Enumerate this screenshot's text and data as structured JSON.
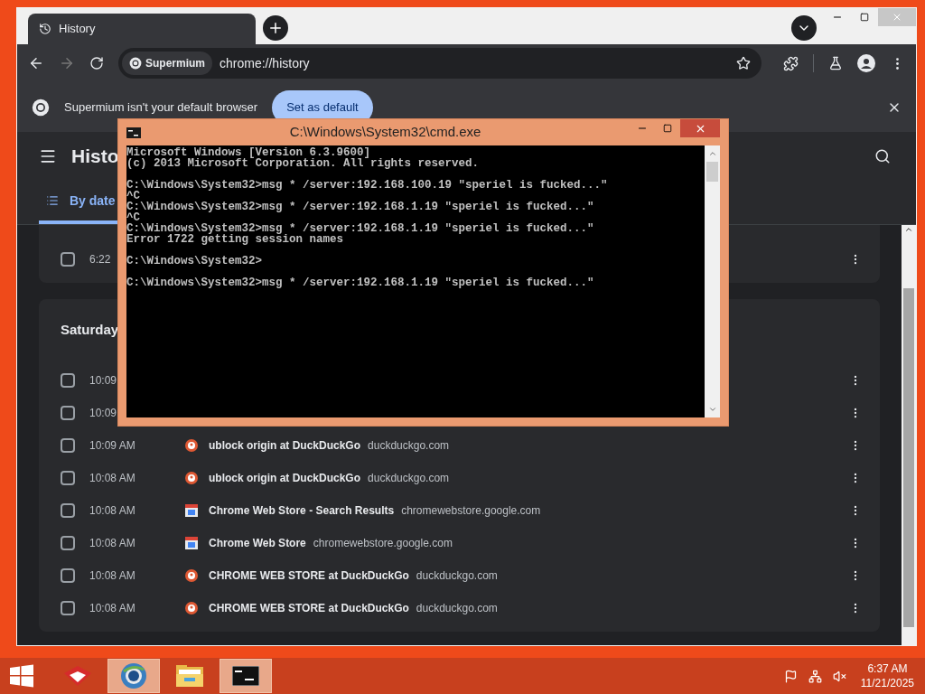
{
  "browser": {
    "tab": {
      "title": "History"
    },
    "address": {
      "chip": "Supermium",
      "url": "chrome://history"
    },
    "infobar": {
      "message": "Supermium isn't your default browser",
      "button": "Set as default"
    },
    "page": {
      "title": "Histo",
      "tabs": [
        {
          "label": "By date",
          "selected": true
        }
      ],
      "groups": [
        {
          "rows": [
            {
              "kind": "covered",
              "time": "6:22",
              "checked": false
            }
          ]
        },
        {
          "heading": "Saturday",
          "rows": [
            {
              "kind": "covered",
              "time": "10:09",
              "checked": false
            },
            {
              "kind": "covered",
              "time": "10:09",
              "checked": false
            },
            {
              "kind": "duck",
              "time": "10:09 AM",
              "title": "ublock origin at DuckDuckGo",
              "domain": "duckduckgo.com",
              "checked": false
            },
            {
              "kind": "duck",
              "time": "10:08 AM",
              "title": "ublock origin at DuckDuckGo",
              "domain": "duckduckgo.com",
              "checked": false
            },
            {
              "kind": "store",
              "time": "10:08 AM",
              "title": "Chrome Web Store - Search Results",
              "domain": "chromewebstore.google.com",
              "checked": false
            },
            {
              "kind": "store",
              "time": "10:08 AM",
              "title": "Chrome Web Store",
              "domain": "chromewebstore.google.com",
              "checked": false
            },
            {
              "kind": "duck",
              "time": "10:08 AM",
              "title": "CHROME WEB STORE at DuckDuckGo",
              "domain": "duckduckgo.com",
              "checked": false
            },
            {
              "kind": "duck",
              "time": "10:08 AM",
              "title": "CHROME WEB STORE at DuckDuckGo",
              "domain": "duckduckgo.com",
              "checked": false
            }
          ]
        }
      ]
    }
  },
  "console": {
    "title": "C:\\Windows\\System32\\cmd.exe",
    "output": "Microsoft Windows [Version 6.3.9600]\n(c) 2013 Microsoft Corporation. All rights reserved.\n\nC:\\Windows\\System32>msg * /server:192.168.100.19 \"speriel is fucked...\"\n^C\nC:\\Windows\\System32>msg * /server:192.168.1.19 \"speriel is fucked...\"\n^C\nC:\\Windows\\System32>msg * /server:192.168.1.19 \"speriel is fucked...\"\nError 1722 getting session names\n\nC:\\Windows\\System32>\n\nC:\\Windows\\System32>msg * /server:192.168.1.19 \"speriel is fucked...\""
  },
  "taskbar": {
    "apps": [
      {
        "kind": "box",
        "selected": false
      },
      {
        "kind": "browser",
        "selected": true
      },
      {
        "kind": "folder",
        "selected": false
      },
      {
        "kind": "console",
        "selected": true
      }
    ],
    "clock": {
      "time": "6:37 AM",
      "date": "11/21/2025"
    }
  }
}
